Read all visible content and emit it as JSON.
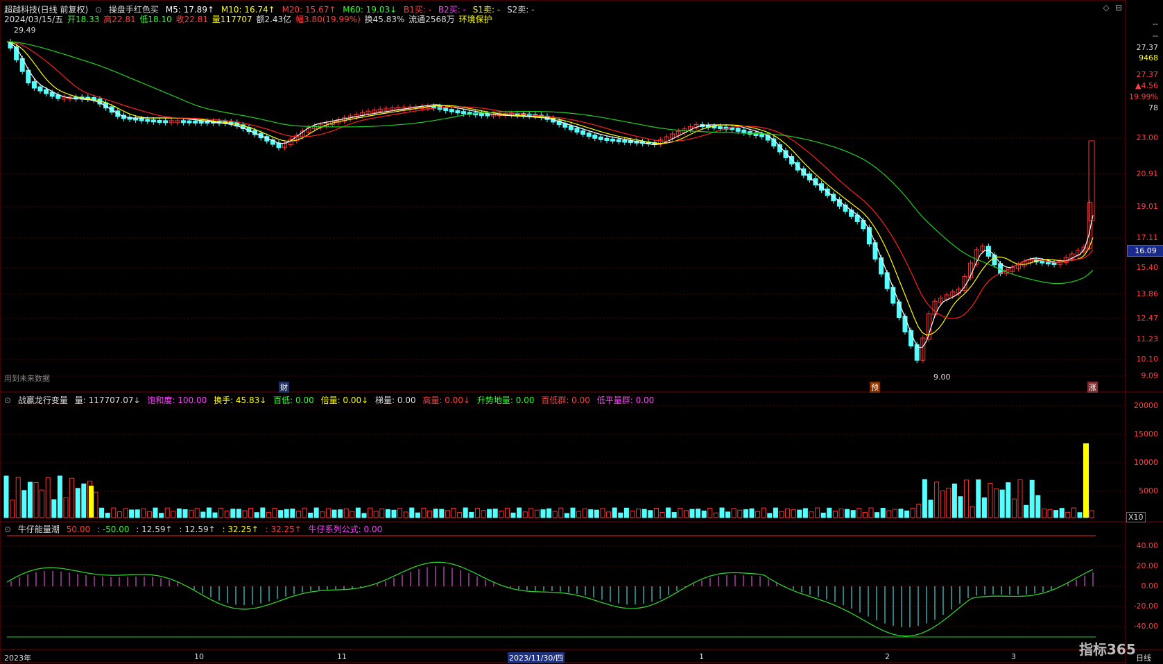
{
  "header1": {
    "stock_name": "超越科技(日线 前复权)",
    "indicator": "操盘手红色买",
    "m5": "M5: 17.89↑",
    "m10": "M10: 16.74↑",
    "m20": "M20: 15.67↑",
    "m60": "M60: 19.03↓",
    "b1": "B1买: -",
    "b2": "B2买: -",
    "s1": "S1卖: -",
    "s2": "S2卖: -"
  },
  "header2": {
    "date": "2024/03/15/五",
    "open": "开18.33",
    "high": "高22.81",
    "low": "低18.10",
    "close": "收22.81",
    "vol": "量117707",
    "amount": "额2.43亿",
    "change": "幅3.80(19.99%)",
    "turnover": "换45.83%",
    "float": "流通2568万",
    "env": "环境保护"
  },
  "price_axis": [
    "23.00",
    "20.91",
    "19.01",
    "17.11",
    "15.40",
    "13.86",
    "12.47",
    "11.23",
    "10.10",
    "9.09"
  ],
  "right_panel": {
    "dash1": "--",
    "dash2": "--",
    "v1": "27.37",
    "v2": "9468",
    "v3": "27.37",
    "v4": "▲4.56",
    "v5": "19.99%",
    "v6": "78"
  },
  "current_price": "16.09",
  "high_marker": "29.49",
  "low_marker": "9.00",
  "future_data_note": "用到未来数据",
  "bottom_tags": {
    "cai": "财",
    "yu": "预",
    "zhang": "涨"
  },
  "vol_panel": {
    "title": "战赢龙行变量",
    "vol": "量: 117707.07↓",
    "saturation": "饱和度: 100.00",
    "turnover": "换手: 45.83↓",
    "hundred_low": "百低: 0.00",
    "multi": "倍量: 0.00↓",
    "ladder": "梯量: 0.00",
    "high_vol": "高量: 0.00↓",
    "rise_ground": "升势地量: 0.00",
    "hundred_low_group": "百低群: 0.00",
    "low_flat": "低平量群: 0.00",
    "axis": [
      "20000",
      "15000",
      "10000",
      "5000"
    ],
    "unit": "X10"
  },
  "energy_panel": {
    "title": "牛仔能量潮",
    "v1": "50.00",
    "v2": ": -50.00",
    "v3": ": 12.59↑",
    "v4": ": 12.59↑",
    "v5": ": 32.25↑",
    "v6": ": 32.25↑",
    "formula": "牛仔系列公式: 0.00",
    "axis": [
      "40.00",
      "20.00",
      "0.00",
      "-20.00",
      "-40.00"
    ]
  },
  "x_axis": {
    "y2023": "2023年",
    "m10": "10",
    "m11": "11",
    "date_box": "2023/11/30/四",
    "m1": "1",
    "m2": "2",
    "m3": "3",
    "period": "日线"
  },
  "logo": "指标365",
  "colors": {
    "up": "#ff3030",
    "down": "#54ffff",
    "ma5": "#ffffff",
    "ma10": "#ffff00",
    "ma20": "#ff2020",
    "ma60": "#20d020"
  }
}
